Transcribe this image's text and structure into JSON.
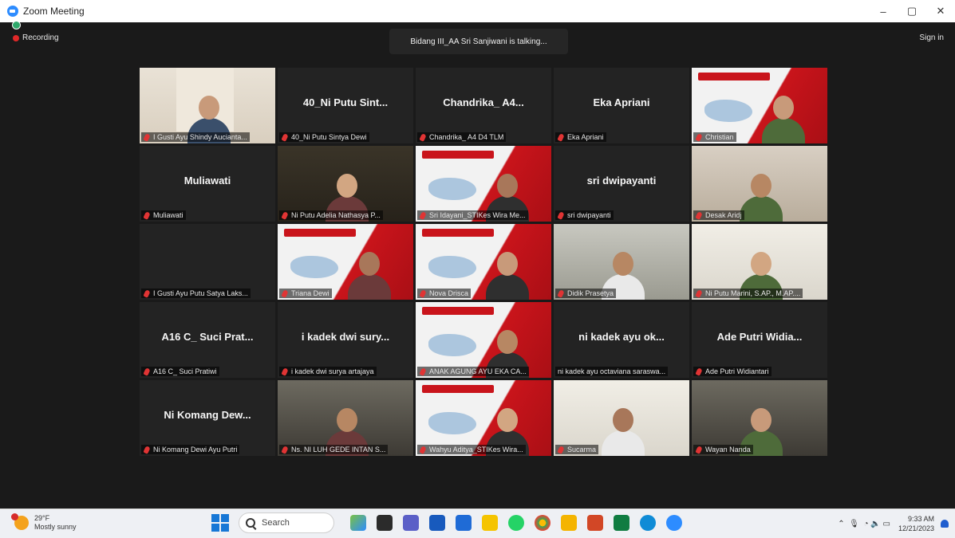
{
  "window": {
    "title": "Zoom Meeting",
    "controls": {
      "minimize": "–",
      "restore": "▢",
      "close": "✕"
    }
  },
  "meeting": {
    "recording_label": "Recording",
    "talking_banner": "Bidang III_AA Sri Sanjiwani is talking...",
    "signin_label": "Sign in"
  },
  "tiles": [
    {
      "name": "I Gusti Ayu Shindy Aucianta...",
      "video": "room1"
    },
    {
      "name": "40_Ni Putu Sintya Dewi",
      "big": "40_Ni Putu Sint..."
    },
    {
      "name": "Chandrika_ A4 D4 TLM",
      "big": "Chandrika_ A4..."
    },
    {
      "name": "Eka Apriani",
      "big": "Eka Apriani"
    },
    {
      "name": "Christian",
      "video": "poster"
    },
    {
      "name": "Muliawati",
      "big": "Muliawati"
    },
    {
      "name": "Ni Putu Adelia Nathasya P...",
      "video": "room2"
    },
    {
      "name": "Sri Idayani_STIKes Wira Me...",
      "video": "poster"
    },
    {
      "name": "sri dwipayanti",
      "big": "sri dwipayanti"
    },
    {
      "name": "Desak Aridj",
      "video": "room3"
    },
    {
      "name": "I Gusti Ayu Putu Satya Laks...",
      "big": ""
    },
    {
      "name": "Triana Dewi",
      "video": "poster"
    },
    {
      "name": "Nova Drisca",
      "video": "poster"
    },
    {
      "name": "Didik Prasetya",
      "video": "room4"
    },
    {
      "name": "Ni Putu Marini, S.AP., M.AP....",
      "video": "room5"
    },
    {
      "name": "A16 C_ Suci Pratiwi",
      "big": "A16 C_ Suci Prat..."
    },
    {
      "name": "i kadek dwi surya artajaya",
      "big": "i kadek dwi sury..."
    },
    {
      "name": "ANAK AGUNG AYU EKA CA...",
      "video": "poster"
    },
    {
      "name": "ni kadek ayu octaviana saraswa...",
      "big": "ni kadek ayu ok...",
      "nomic": true
    },
    {
      "name": "Ade Putri Widiantari",
      "big": "Ade Putri Widia..."
    },
    {
      "name": "Ni Komang Dewi Ayu Putri",
      "big": "Ni Komang Dew..."
    },
    {
      "name": "Ns. NI LUH GEDE INTAN S...",
      "video": "room6"
    },
    {
      "name": "Wahyu Aditya_STIKes Wira...",
      "video": "poster"
    },
    {
      "name": "Sucarma",
      "video": "room5"
    },
    {
      "name": "Wayan Nanda",
      "video": "room6"
    }
  ],
  "taskbar": {
    "weather_temp": "29°F",
    "weather_desc": "Mostly sunny",
    "search_label": "Search",
    "time": "9:33 AM",
    "date": "12/21/2023",
    "tray_icons": [
      "chevron-up-icon",
      "mic-icon",
      "wifi-icon",
      "volume-icon",
      "battery-icon"
    ]
  },
  "colors": {
    "accent": "#2d8cff",
    "recording": "#e02828",
    "mute": "#e03434",
    "meeting_bg": "#1a1a1a"
  }
}
